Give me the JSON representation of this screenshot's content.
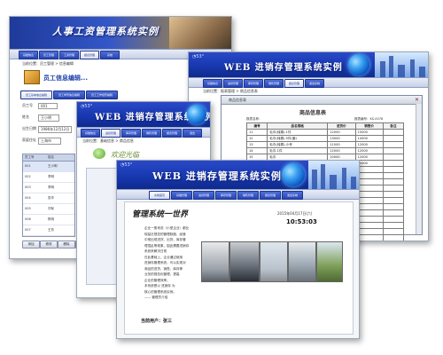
{
  "win1": {
    "banner_title": "人事工资管理系统实例",
    "nav": [
      "基础信息",
      "员工管理",
      "工资管理",
      "报表管理",
      "系统"
    ],
    "breadcrumb": "当前位置：员工管理 > 信息编辑",
    "heading": "员工信息编辑...",
    "tabs": [
      "员工基本信息编辑",
      "员工学历信息编辑",
      "员工工作经历编辑"
    ],
    "fields": [
      {
        "label": "员工号",
        "value": "001"
      },
      {
        "label": "姓名",
        "value": "王小明"
      },
      {
        "label": "出生日期",
        "value": "1986年12月12日"
      },
      {
        "label": "家庭住址",
        "value": "上海市"
      }
    ],
    "list_headers": [
      "员工号",
      "姓名"
    ],
    "list_rows": [
      [
        "001",
        "王小明"
      ],
      [
        "002",
        "李明"
      ],
      [
        "003",
        "李明"
      ],
      [
        "004",
        "张华"
      ],
      [
        "005",
        "刘军"
      ],
      [
        "006",
        "陈明"
      ],
      [
        "007",
        "王芳"
      ]
    ],
    "buttons": [
      "添加",
      "修改",
      "删除",
      "保存"
    ]
  },
  "win2": {
    "banner_title": "WEB 进销存管理系统实例",
    "nav": [
      "基础信息",
      "进货管理",
      "库存管理",
      "销售管理",
      "报表管理",
      "退出系统"
    ],
    "breadcrumb": "当前位置：报表管理 > 商品信息表",
    "doc_window_title": "商品信息表",
    "report_title": "商品信息表",
    "report_meta_left": "报表名称：",
    "report_meta_right": "报表编号：KS-0078",
    "table_headers": [
      "编号",
      "品名规格",
      "进货价",
      "销售价",
      "备注"
    ],
    "table_rows": [
      [
        "11",
        "毛巾(纯棉)-1件",
        "12000",
        "15000",
        ""
      ],
      [
        "12",
        "毛巾(纯棉)-5件(套)",
        "13000",
        "14500",
        ""
      ],
      [
        "13",
        "毛巾(纯棉)-小号",
        "11000",
        "12000",
        ""
      ],
      [
        "14",
        "毛巾-1件",
        "12000",
        "12000",
        ""
      ],
      [
        "15",
        "毛巾",
        "10000",
        "12000",
        ""
      ],
      [
        "16",
        "毛巾(小号)",
        "14000",
        "15000",
        ""
      ]
    ]
  },
  "win3": {
    "banner_title": "WEB 进销存管理系统实例",
    "nav": [
      "基础信息",
      "进货管理",
      "库存管理",
      "销售管理",
      "报表管理",
      "退出"
    ],
    "breadcrumb": "当前位置：基础信息 > 商品信息",
    "welcome": "欢迎光临"
  },
  "win4": {
    "banner_title": "WEB 进销存管理系统实例",
    "nav": [
      "系统首页",
      "基础管理",
      "进货管理",
      "库存管理",
      "销售管理",
      "报表管理",
      "退出系统"
    ],
    "slogan": "管理系统一世界",
    "date": "2015年04月17日(六)",
    "time": "10:53:03",
    "body_text": [
      "企业一般来说（小型企业）都比",
      "较缺乏规范的管理制度，经营",
      "中常出现进货、出货、库存管",
      "理混乱等现象，因此需要进销存",
      "系统来解决日常",
      "在此基础上，企业通过使用",
      "进销存管理系统，可以实现对",
      "商品的进货、销售、库存等",
      "业务的规范化管理，提高",
      "企业的管理效率。",
      "",
      "本系统是以 进销存 为",
      "核心的管理系统实例。",
      "—— 管理员介绍"
    ],
    "user_label": "当前用户：张三"
  }
}
